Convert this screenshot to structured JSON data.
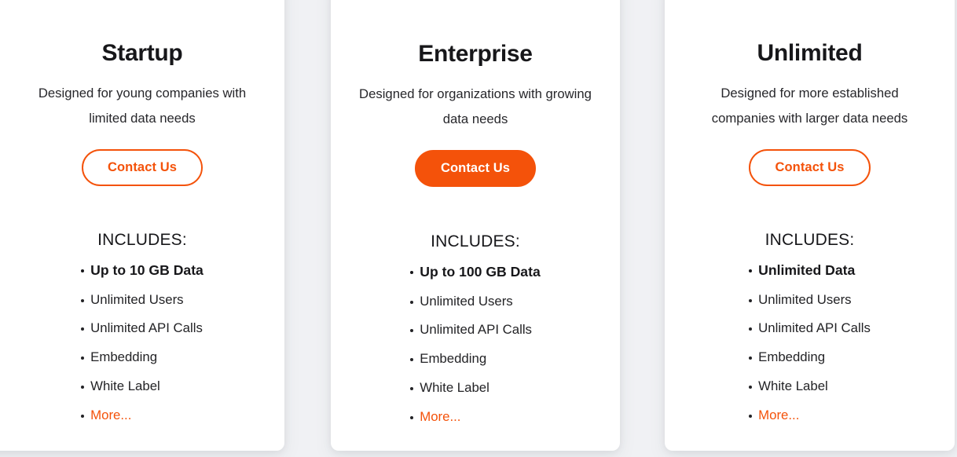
{
  "theme": {
    "accent": "#f4520a",
    "page_background": "#f0f1f4",
    "card_background": "#ffffff",
    "text_color": "#17171a"
  },
  "plans": [
    {
      "name": "Startup",
      "description": "Designed for young companies with limited data needs",
      "cta": {
        "label": "Contact Us",
        "style": "outline"
      },
      "includes_label": "INCLUDES:",
      "features": [
        {
          "label": "Up to 10 GB Data",
          "emphasis": "strong"
        },
        {
          "label": "Unlimited Users",
          "emphasis": "normal"
        },
        {
          "label": "Unlimited API Calls",
          "emphasis": "normal"
        },
        {
          "label": "Embedding",
          "emphasis": "normal"
        },
        {
          "label": "White Label",
          "emphasis": "normal"
        },
        {
          "label": "More...",
          "emphasis": "link"
        }
      ]
    },
    {
      "name": "Enterprise",
      "description": "Designed for organizations with growing data needs",
      "cta": {
        "label": "Contact Us",
        "style": "solid"
      },
      "includes_label": "INCLUDES:",
      "features": [
        {
          "label": "Up to 100 GB Data",
          "emphasis": "strong"
        },
        {
          "label": "Unlimited Users",
          "emphasis": "normal"
        },
        {
          "label": "Unlimited API Calls",
          "emphasis": "normal"
        },
        {
          "label": "Embedding",
          "emphasis": "normal"
        },
        {
          "label": "White Label",
          "emphasis": "normal"
        },
        {
          "label": "More...",
          "emphasis": "link"
        }
      ]
    },
    {
      "name": "Unlimited",
      "description": "Designed for more established companies with larger data needs",
      "cta": {
        "label": "Contact Us",
        "style": "outline"
      },
      "includes_label": "INCLUDES:",
      "features": [
        {
          "label": "Unlimited Data",
          "emphasis": "strong"
        },
        {
          "label": "Unlimited Users",
          "emphasis": "normal"
        },
        {
          "label": "Unlimited API Calls",
          "emphasis": "normal"
        },
        {
          "label": "Embedding",
          "emphasis": "normal"
        },
        {
          "label": "White Label",
          "emphasis": "normal"
        },
        {
          "label": "More...",
          "emphasis": "link"
        }
      ]
    }
  ]
}
